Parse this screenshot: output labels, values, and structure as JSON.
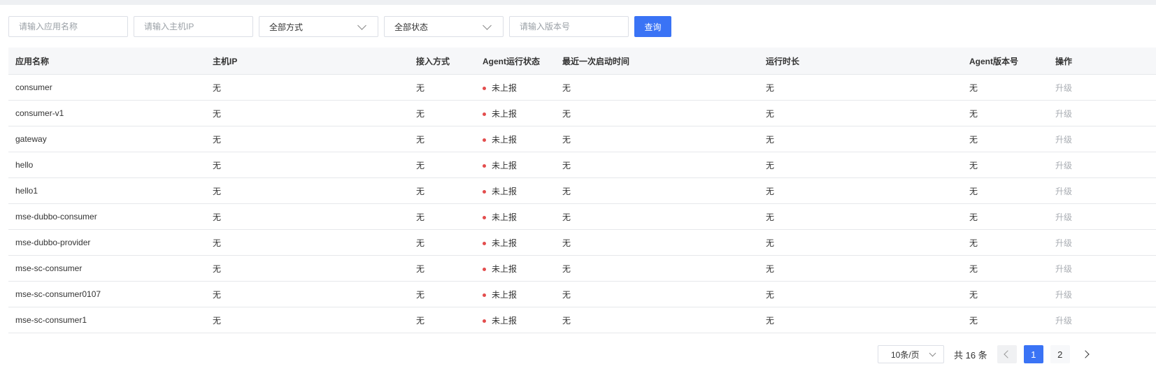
{
  "filters": {
    "app_name_placeholder": "请输入应用名称",
    "host_ip_placeholder": "请输入主机IP",
    "method_select": "全部方式",
    "status_select": "全部状态",
    "version_placeholder": "请输入版本号",
    "query_label": "查询"
  },
  "table": {
    "headers": {
      "app_name": "应用名称",
      "host_ip": "主机IP",
      "access_method": "接入方式",
      "agent_status": "Agent运行状态",
      "last_start": "最近一次启动时间",
      "uptime": "运行时长",
      "agent_version": "Agent版本号",
      "actions": "操作"
    },
    "rows": [
      {
        "app_name": "consumer",
        "host_ip": "无",
        "access_method": "无",
        "agent_status": "未上报",
        "last_start": "无",
        "uptime": "无",
        "agent_version": "无",
        "action": "升级"
      },
      {
        "app_name": "consumer-v1",
        "host_ip": "无",
        "access_method": "无",
        "agent_status": "未上报",
        "last_start": "无",
        "uptime": "无",
        "agent_version": "无",
        "action": "升级"
      },
      {
        "app_name": "gateway",
        "host_ip": "无",
        "access_method": "无",
        "agent_status": "未上报",
        "last_start": "无",
        "uptime": "无",
        "agent_version": "无",
        "action": "升级"
      },
      {
        "app_name": "hello",
        "host_ip": "无",
        "access_method": "无",
        "agent_status": "未上报",
        "last_start": "无",
        "uptime": "无",
        "agent_version": "无",
        "action": "升级"
      },
      {
        "app_name": "hello1",
        "host_ip": "无",
        "access_method": "无",
        "agent_status": "未上报",
        "last_start": "无",
        "uptime": "无",
        "agent_version": "无",
        "action": "升级"
      },
      {
        "app_name": "mse-dubbo-consumer",
        "host_ip": "无",
        "access_method": "无",
        "agent_status": "未上报",
        "last_start": "无",
        "uptime": "无",
        "agent_version": "无",
        "action": "升级"
      },
      {
        "app_name": "mse-dubbo-provider",
        "host_ip": "无",
        "access_method": "无",
        "agent_status": "未上报",
        "last_start": "无",
        "uptime": "无",
        "agent_version": "无",
        "action": "升级"
      },
      {
        "app_name": "mse-sc-consumer",
        "host_ip": "无",
        "access_method": "无",
        "agent_status": "未上报",
        "last_start": "无",
        "uptime": "无",
        "agent_version": "无",
        "action": "升级"
      },
      {
        "app_name": "mse-sc-consumer0107",
        "host_ip": "无",
        "access_method": "无",
        "agent_status": "未上报",
        "last_start": "无",
        "uptime": "无",
        "agent_version": "无",
        "action": "升级"
      },
      {
        "app_name": "mse-sc-consumer1",
        "host_ip": "无",
        "access_method": "无",
        "agent_status": "未上报",
        "last_start": "无",
        "uptime": "无",
        "agent_version": "无",
        "action": "升级"
      }
    ]
  },
  "pagination": {
    "page_size": "10条/页",
    "total_text": "共 16 条",
    "current_page": "1",
    "page_2": "2"
  },
  "colors": {
    "primary": "#3a73f5",
    "status_dot": "#e34d4d",
    "disabled_link": "#a9adb3"
  }
}
